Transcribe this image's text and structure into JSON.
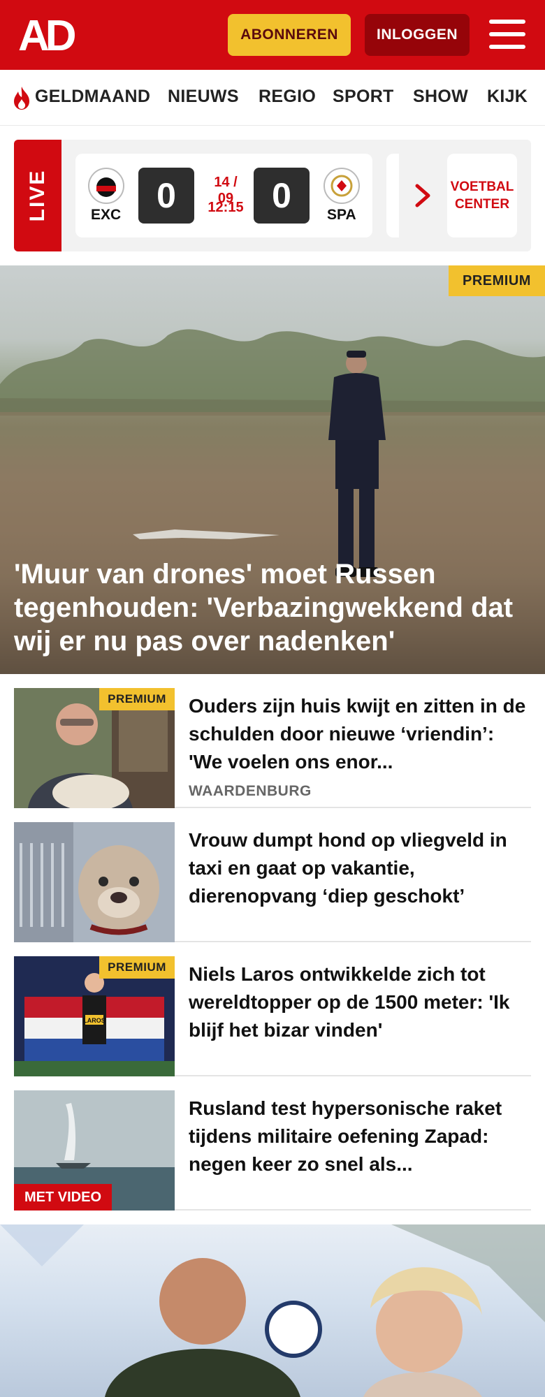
{
  "header": {
    "logo_text": "AD",
    "subscribe_label": "ABONNEREN",
    "login_label": "INLOGGEN"
  },
  "nav": {
    "items": [
      "GELDMAAND",
      "NIEUWS",
      "REGIO",
      "SPORT",
      "SHOW",
      "KIJK"
    ]
  },
  "live": {
    "label": "LIVE",
    "match": {
      "home_code": "EXC",
      "away_code": "SPA",
      "home_score": "0",
      "away_score": "0",
      "date": "14 / 09",
      "time": "12:15"
    },
    "voetbal_center_label": "VOETBAL CENTER"
  },
  "hero": {
    "badge": "PREMIUM",
    "title": "'Muur van drones' moet Russen tegenhouden: 'Verbazingwekkend dat wij er nu pas over nadenken'"
  },
  "articles": [
    {
      "badge": "PREMIUM",
      "title": "Ouders zijn huis kwijt en zitten in de schulden door nieuwe ‘vriendin’: 'We voelen ons enor...",
      "location": "WAARDENBURG"
    },
    {
      "title": "Vrouw dumpt hond op vliegveld in taxi en gaat op vakantie, dierenopvang ‘diep geschokt’"
    },
    {
      "badge": "PREMIUM",
      "title": "Niels Laros ontwikkelde zich tot wereldtopper op de 1500 meter: 'Ik blijf het bizar vinden'",
      "bib_text": "LAROS"
    },
    {
      "video_badge": "MET VIDEO",
      "title": "Rusland test hypersonische raket tijdens militaire oefening Zapad: negen keer zo snel als..."
    }
  ],
  "colors": {
    "brand_red": "#d10a11",
    "login_dark_red": "#960409",
    "premium_yellow": "#f2c12e"
  }
}
